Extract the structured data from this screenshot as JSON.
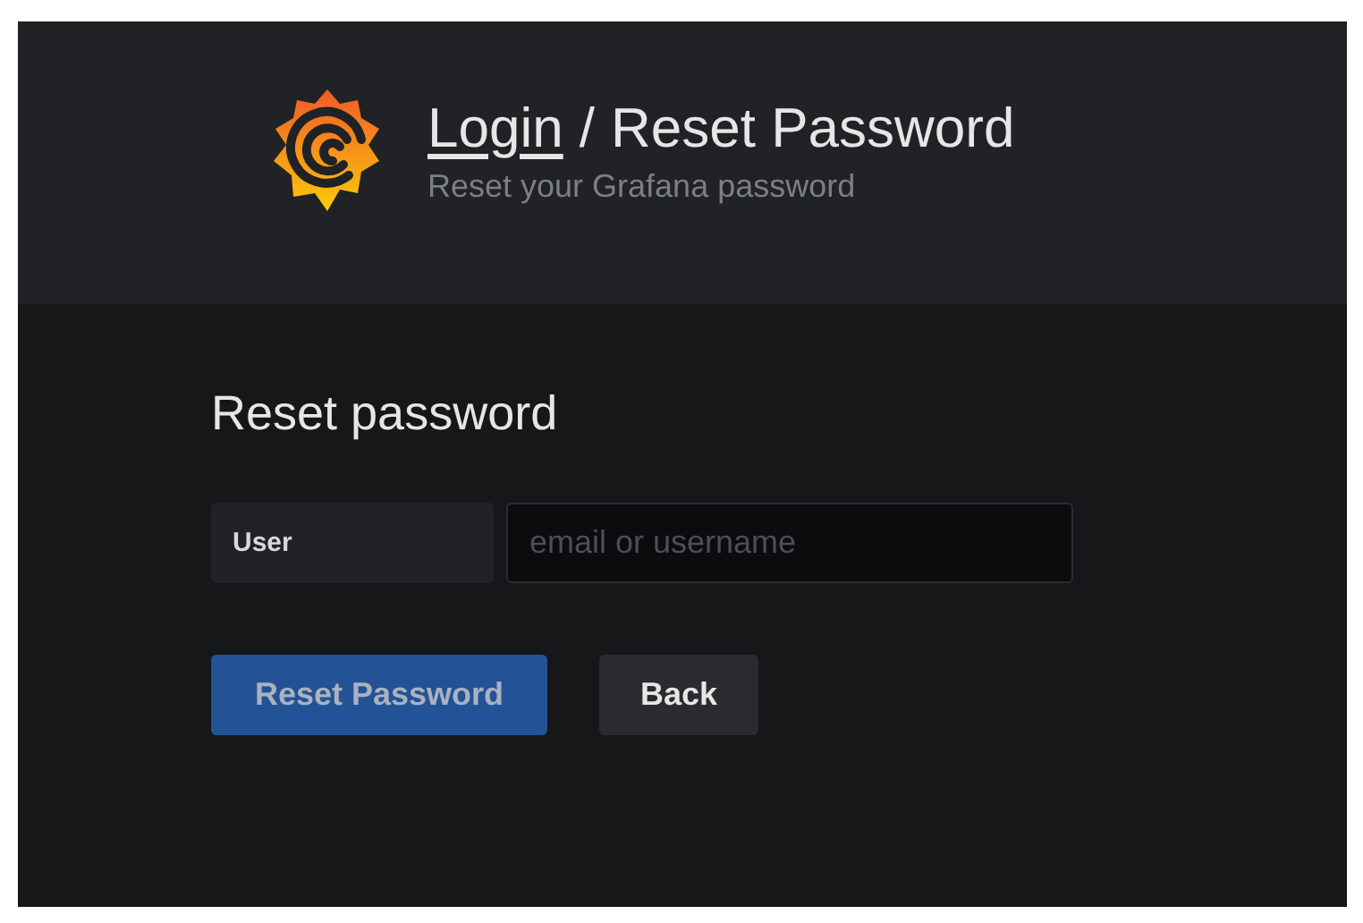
{
  "header": {
    "breadcrumb_link": "Login",
    "separator": "/",
    "title": "Reset Password",
    "subtitle": "Reset your Grafana password"
  },
  "form": {
    "heading": "Reset password",
    "field_label": "User",
    "placeholder": "email or username"
  },
  "buttons": [
    {
      "label": "Reset Password",
      "kind": "primary",
      "disabled": true
    },
    {
      "label": "Back",
      "kind": "secondary",
      "disabled": false
    }
  ]
}
